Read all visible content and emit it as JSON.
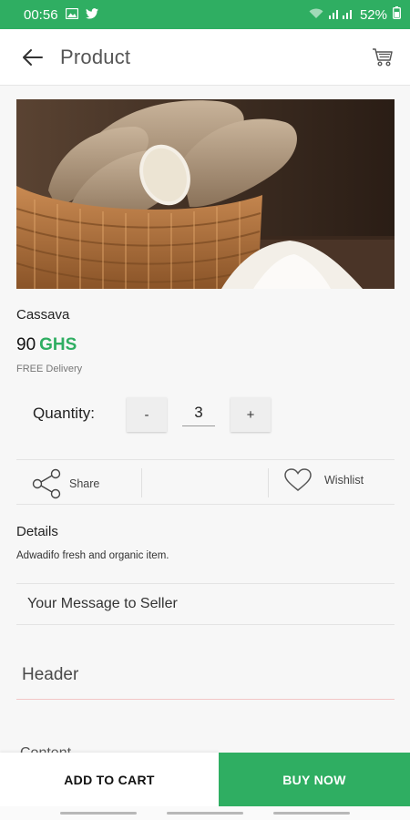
{
  "status_bar": {
    "time": "00:56",
    "battery": "52%",
    "icons": [
      "image-icon",
      "twitter-icon",
      "wifi-icon",
      "signal-icon",
      "battery-icon"
    ]
  },
  "app_bar": {
    "title": "Product",
    "icons": [
      "back-arrow-icon",
      "cart-icon"
    ]
  },
  "product": {
    "image_desc": "cassava-in-basket",
    "name": "Cassava",
    "price_value": "90",
    "price_currency": "GHS",
    "delivery": "FREE Delivery"
  },
  "quantity": {
    "label": "Quantity:",
    "minus_label": "-",
    "value": "3",
    "plus_label": "+"
  },
  "actions": {
    "share_label": "Share",
    "wishlist_label": "Wishlist"
  },
  "details": {
    "title": "Details",
    "text": "Adwadifo fresh and organic item."
  },
  "message_field": {
    "placeholder": "Your Message to Seller"
  },
  "header_field": {
    "placeholder": "Header"
  },
  "content_field": {
    "placeholder": "Content"
  },
  "bottom_bar": {
    "add_to_cart": "ADD TO CART",
    "buy_now": "BUY NOW"
  },
  "colors": {
    "accent": "#2fae62",
    "header_underline": "#f2c6c6"
  }
}
